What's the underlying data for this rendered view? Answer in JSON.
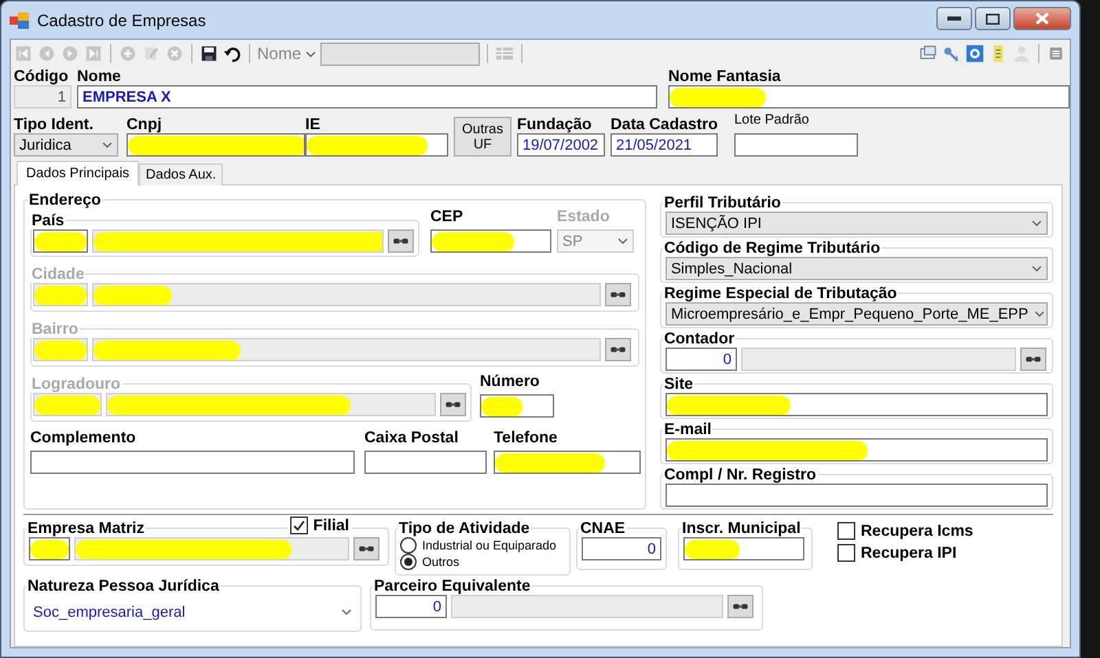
{
  "window": {
    "title": "Cadastro de Empresas"
  },
  "toolbar": {
    "left": [
      {
        "kind": "first",
        "disabled": true
      },
      {
        "kind": "prev",
        "disabled": true
      },
      {
        "kind": "next",
        "disabled": true
      },
      {
        "kind": "last",
        "disabled": true
      },
      {
        "kind": "separator"
      },
      {
        "kind": "add",
        "disabled": true
      },
      {
        "kind": "edit",
        "disabled": true
      },
      {
        "kind": "delete",
        "disabled": true
      },
      {
        "kind": "separator"
      },
      {
        "kind": "save",
        "disabled": false
      },
      {
        "kind": "undo",
        "disabled": false
      }
    ],
    "search_by": "Nome",
    "search_field": {
      "disabled": true
    },
    "right": [
      {
        "kind": "window",
        "disabled": false
      },
      {
        "kind": "key",
        "disabled": false
      },
      {
        "kind": "screen",
        "disabled": false
      },
      {
        "kind": "note",
        "disabled": false
      },
      {
        "kind": "user",
        "disabled": true
      },
      {
        "kind": "list",
        "disabled": false
      }
    ]
  },
  "header": {
    "codigo": {
      "label": "Código",
      "value": "1",
      "disabled": true
    },
    "nome": {
      "label": "Nome",
      "value": "EMPRESA X"
    },
    "nome_fantasia": {
      "label": "Nome Fantasia",
      "redacted": true
    },
    "tipo_ident": {
      "label": "Tipo Ident.",
      "value": "Juridica"
    },
    "cnpj": {
      "label": "Cnpj",
      "redacted": true
    },
    "ie": {
      "label": "IE",
      "redacted": true
    },
    "outras_uf_button": "Outras UF",
    "fundacao": {
      "label": "Fundação",
      "value": "19/07/2002"
    },
    "data_cadastro": {
      "label": "Data Cadastro",
      "value": "21/05/2021"
    },
    "lote_padrao": {
      "label": "Lote Padrão"
    }
  },
  "tabs": [
    {
      "label": "Dados Principais",
      "selected": true
    },
    {
      "label": "Dados Aux.",
      "selected": false
    }
  ],
  "endereco": {
    "title": "Endereço",
    "pais": {
      "label": "País",
      "redacted": true,
      "disabled": false
    },
    "cep": {
      "label": "CEP",
      "redacted": true
    },
    "estado": {
      "label": "Estado",
      "value": "SP",
      "disabled": true
    },
    "cidade": {
      "label": "Cidade",
      "redacted": true,
      "disabled": true
    },
    "bairro": {
      "label": "Bairro",
      "redacted": true,
      "disabled": true
    },
    "logradouro": {
      "label": "Logradouro",
      "redacted": true,
      "disabled": true
    },
    "numero": {
      "label": "Número",
      "redacted": true
    },
    "complemento": {
      "label": "Complemento"
    },
    "caixa_postal": {
      "label": "Caixa Postal"
    },
    "telefone": {
      "label": "Telefone",
      "redacted": true
    }
  },
  "fiscal": {
    "perfil_tributario": {
      "label": "Perfil Tributário",
      "value": "ISENÇÃO IPI"
    },
    "codigo_regime": {
      "label": "Código de Regime Tributário",
      "value": "Simples_Nacional"
    },
    "regime_especial": {
      "label": "Regime Especial de Tributação",
      "value": "Microempresário_e_Empr_Pequeno_Porte_ME_EPP"
    },
    "contador": {
      "label": "Contador",
      "value": "0"
    },
    "site": {
      "label": "Site",
      "redacted": true
    },
    "email": {
      "label": "E-mail",
      "redacted": true
    },
    "compl_registro": {
      "label": "Compl / Nr. Registro"
    }
  },
  "bottom": {
    "empresa_matriz": {
      "label": "Empresa Matriz",
      "redacted": true
    },
    "filial": {
      "label": "Filial",
      "checked": true
    },
    "tipo_atividade": {
      "title": "Tipo de Atividade",
      "options": [
        {
          "label": "Industrial ou Equiparado",
          "selected": false
        },
        {
          "label": "Outros",
          "selected": true
        }
      ]
    },
    "cnae": {
      "label": "CNAE",
      "value": "0"
    },
    "inscr_municipal": {
      "label": "Inscr. Municipal",
      "redacted": true
    },
    "checks": [
      {
        "label": "Recupera Icms",
        "checked": false
      },
      {
        "label": "Recupera IPI",
        "checked": false
      }
    ],
    "natureza": {
      "label": "Natureza Pessoa Jurídica",
      "value": "Soc_empresaria_geral"
    },
    "parceiro": {
      "label": "Parceiro Equivalente",
      "value": "0"
    }
  }
}
